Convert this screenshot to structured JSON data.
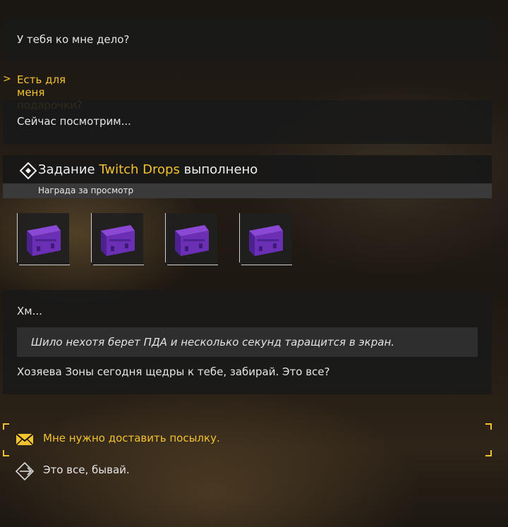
{
  "dialogue": {
    "npc_line_1": "У тебя ко мне дело?",
    "player_prompt_marker": ">",
    "player_prompt": "Есть для меня подарочки?",
    "npc_line_2": "Сейчас посмотрим...",
    "npc_line_3": "Хм...",
    "narration": "Шило нехотя берет ПДА и несколько секунд таращится в экран.",
    "npc_line_4": "Хозяева Зоны сегодня щедры к тебе, забирай. Это все?"
  },
  "quest": {
    "title_prefix": "Задание",
    "title_highlight": "Twitch Drops",
    "title_suffix": "выполнено",
    "subtitle": "Награда за просмотр",
    "rewards": [
      {
        "icon": "purple-crate-icon"
      },
      {
        "icon": "purple-crate-icon"
      },
      {
        "icon": "purple-crate-icon"
      },
      {
        "icon": "purple-crate-icon"
      }
    ]
  },
  "choices": [
    {
      "label": "Мне нужно доставить посылку.",
      "icon": "envelope-icon",
      "selected": true
    },
    {
      "label": "Это все, бывай.",
      "icon": "exit-arrow-icon",
      "selected": false
    }
  ],
  "colors": {
    "accent": "#f2c230",
    "crate": "#6a2fb4",
    "panel": "#1a1a1a"
  }
}
